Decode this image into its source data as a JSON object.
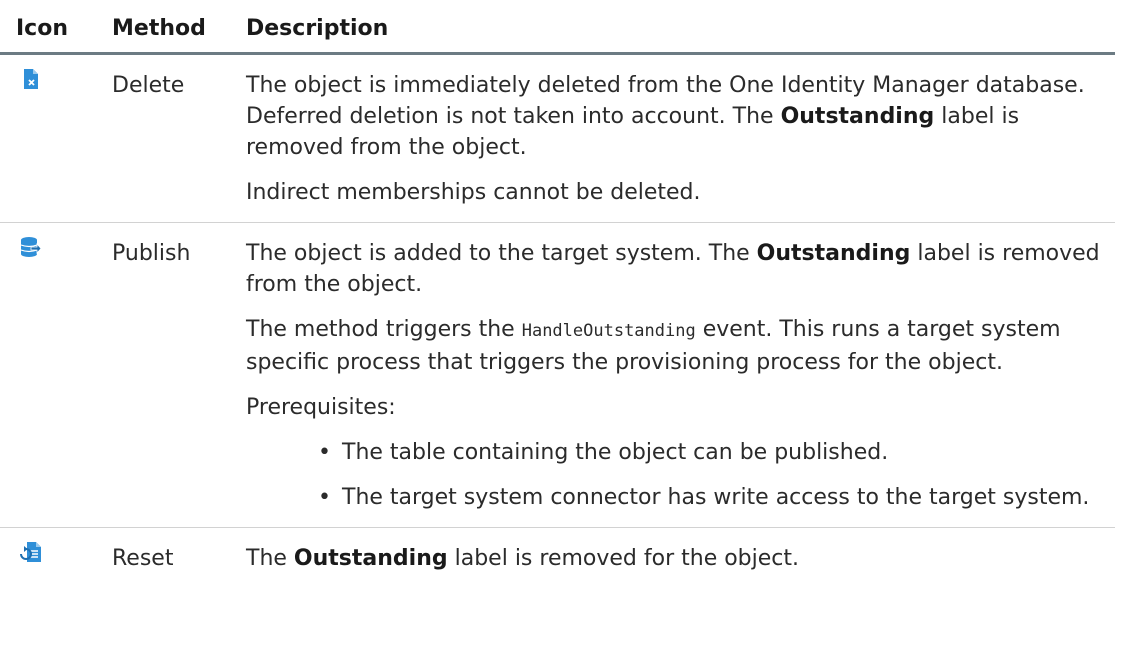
{
  "header": {
    "icon": "Icon",
    "method": "Method",
    "description": "Description"
  },
  "rows": {
    "delete": {
      "icon": "delete-document-icon",
      "method": "Delete",
      "p1_a": "The object is immediately deleted from the One Identity Manager database. Deferred deletion is not taken into account. The ",
      "p1_bold": "Outstanding",
      "p1_b": " label is removed from the object.",
      "p2": "Indirect memberships cannot be deleted."
    },
    "publish": {
      "icon": "publish-database-icon",
      "method": "Publish",
      "p1_a": "The object is added to the target system. The ",
      "p1_bold": "Outstanding",
      "p1_b": " label is removed from the object.",
      "p2_a": "The method triggers the ",
      "p2_code": "HandleOutstanding",
      "p2_b": " event. This runs a target system specific process that triggers the provisioning process for the object.",
      "p3": "Prerequisites:",
      "bullet": "•",
      "bullets": [
        "The table containing the object can be published.",
        "The target system connector has write access to the target system."
      ]
    },
    "reset": {
      "icon": "reset-document-icon",
      "method": "Reset",
      "p1_a": "The ",
      "p1_bold": "Outstanding",
      "p1_b": " label is removed for the object."
    }
  },
  "colors": {
    "icon_blue": "#2f8fd8",
    "header_rule": "#6c7b83",
    "row_rule": "#d2d2d2"
  }
}
